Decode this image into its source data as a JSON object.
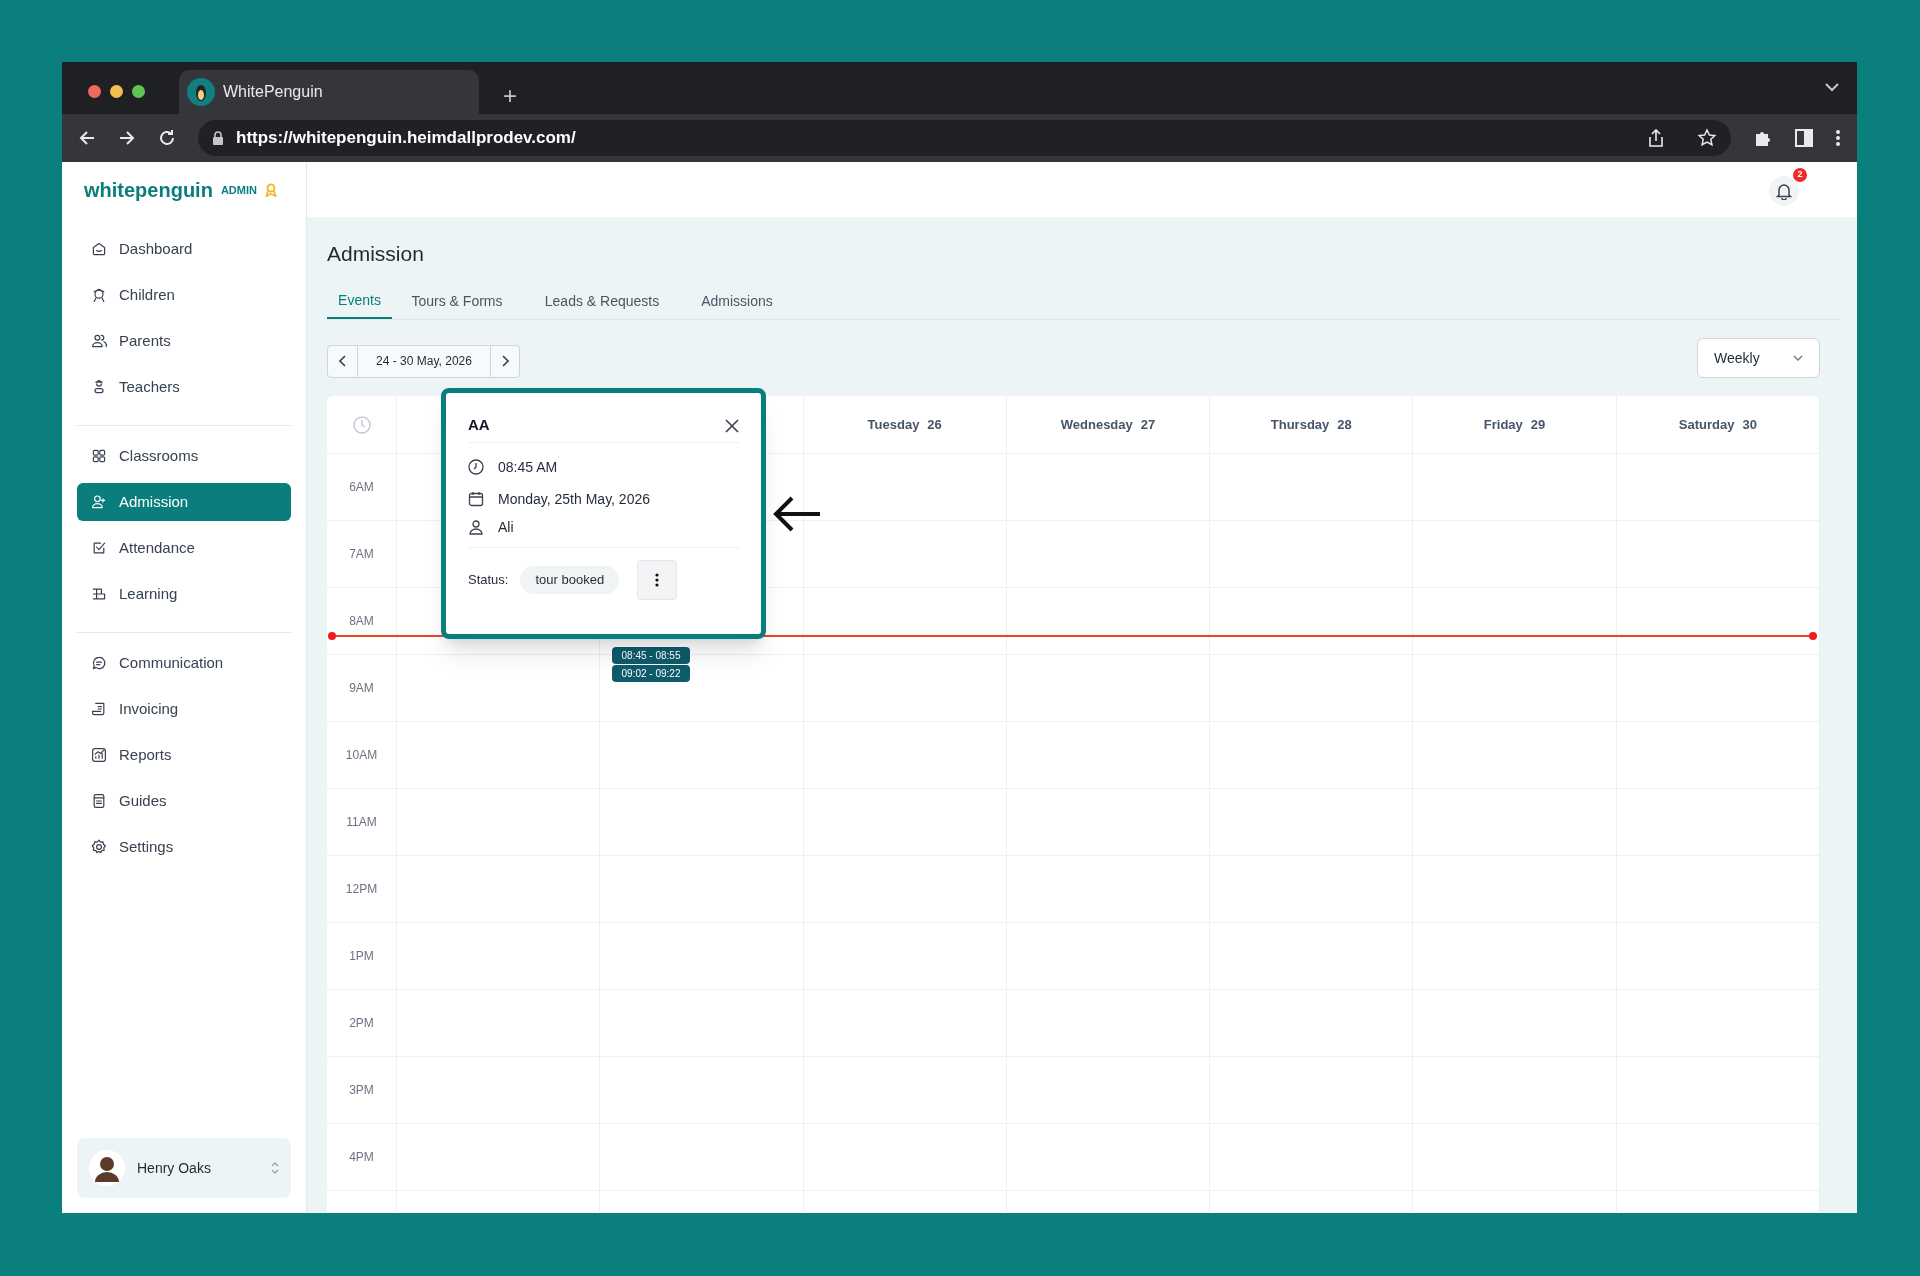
{
  "browser": {
    "tab_title": "WhitePenguin",
    "new_tab": "+",
    "url": "https://whitepenguin.heimdallprodev.com/"
  },
  "sidebar": {
    "logo": "whitepenguin",
    "role": "ADMIN",
    "groups": [
      [
        {
          "label": "Dashboard",
          "selected": false
        },
        {
          "label": "Children",
          "selected": false
        },
        {
          "label": "Parents",
          "selected": false
        },
        {
          "label": "Teachers",
          "selected": false
        }
      ],
      [
        {
          "label": "Classrooms",
          "selected": false
        },
        {
          "label": "Admission",
          "selected": true
        },
        {
          "label": "Attendance",
          "selected": false
        },
        {
          "label": "Learning",
          "selected": false
        }
      ],
      [
        {
          "label": "Communication",
          "selected": false
        },
        {
          "label": "Invoicing",
          "selected": false
        },
        {
          "label": "Reports",
          "selected": false
        },
        {
          "label": "Guides",
          "selected": false
        },
        {
          "label": "Settings",
          "selected": false
        }
      ]
    ],
    "user": {
      "name": "Henry Oaks"
    }
  },
  "header": {
    "notification_count": "2"
  },
  "page": {
    "title": "Admission",
    "tabs": [
      {
        "label": "Events",
        "selected": true
      },
      {
        "label": "Tours & Forms",
        "selected": false
      },
      {
        "label": "Leads & Requests",
        "selected": false
      },
      {
        "label": "Admissions",
        "selected": false
      }
    ],
    "date_range": "24 - 30 May, 2026",
    "view": "Weekly"
  },
  "calendar": {
    "days": [
      {
        "name": "Tuesday",
        "date": "26"
      },
      {
        "name": "Wednesday",
        "date": "27"
      },
      {
        "name": "Thursday",
        "date": "28"
      },
      {
        "name": "Friday",
        "date": "29"
      },
      {
        "name": "Saturday",
        "date": "30"
      }
    ],
    "hours": [
      "6AM",
      "7AM",
      "8AM",
      "9AM",
      "10AM",
      "11AM",
      "12PM",
      "1PM",
      "2PM",
      "3PM",
      "4PM"
    ],
    "events": [
      {
        "time": "08:45 - 08:55"
      },
      {
        "time": "09:02 - 09:22"
      }
    ]
  },
  "popup": {
    "title": "AA",
    "time": "08:45 AM",
    "date": "Monday, 25th May, 2026",
    "person": "Ali",
    "status_label": "Status:",
    "status": "tour booked"
  }
}
